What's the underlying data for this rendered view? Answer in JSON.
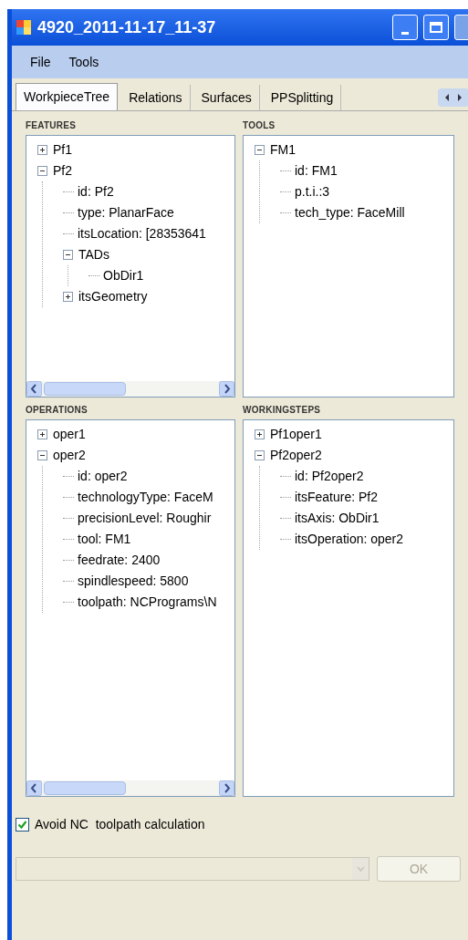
{
  "window": {
    "title": "4920_2011-11-17_11-37"
  },
  "menu": [
    "File",
    "Tools"
  ],
  "tabs": [
    {
      "label": "WorkpieceTree",
      "selected": true
    },
    {
      "label": "Relations",
      "selected": false
    },
    {
      "label": "Surfaces",
      "selected": false
    },
    {
      "label": "PPSplitting",
      "selected": false
    }
  ],
  "panels": [
    {
      "title": "FEATURES",
      "hscroll": true,
      "tree": [
        {
          "label": "Pf1",
          "expanded": false
        },
        {
          "label": "Pf2",
          "expanded": true,
          "children": [
            {
              "label": "id: Pf2"
            },
            {
              "label": "type: PlanarFace"
            },
            {
              "label": "itsLocation: [28353641"
            },
            {
              "label": "TADs",
              "expanded": true,
              "children": [
                {
                  "label": "ObDir1"
                }
              ]
            },
            {
              "label": "itsGeometry",
              "expanded": false
            }
          ]
        }
      ]
    },
    {
      "title": "TOOLS",
      "hscroll": false,
      "tree": [
        {
          "label": "FM1",
          "expanded": true,
          "children": [
            {
              "label": "id: FM1"
            },
            {
              "label": "p.t.i.:3"
            },
            {
              "label": "tech_type: FaceMill"
            }
          ]
        }
      ]
    },
    {
      "title": "OPERATIONS",
      "hscroll": true,
      "tree": [
        {
          "label": "oper1",
          "expanded": false
        },
        {
          "label": "oper2",
          "expanded": true,
          "children": [
            {
              "label": "id: oper2"
            },
            {
              "label": "technologyType: FaceM"
            },
            {
              "label": "precisionLevel: Roughir"
            },
            {
              "label": "tool: FM1"
            },
            {
              "label": "feedrate: 2400"
            },
            {
              "label": "spindlespeed: 5800"
            },
            {
              "label": "toolpath: NCPrograms\\N"
            }
          ]
        }
      ]
    },
    {
      "title": "WORKINGSTEPS",
      "hscroll": false,
      "tree": [
        {
          "label": "Pf1oper1",
          "expanded": false
        },
        {
          "label": "Pf2oper2",
          "expanded": true,
          "children": [
            {
              "label": "id: Pf2oper2"
            },
            {
              "label": "itsFeature: Pf2"
            },
            {
              "label": "itsAxis: ObDir1"
            },
            {
              "label": "itsOperation: oper2"
            }
          ]
        }
      ]
    }
  ],
  "option": {
    "label": "Avoid NC  toolpath calculation",
    "checked": true
  },
  "combo": {
    "disabled": true
  },
  "ok_button": {
    "label": "OK",
    "disabled": true
  }
}
